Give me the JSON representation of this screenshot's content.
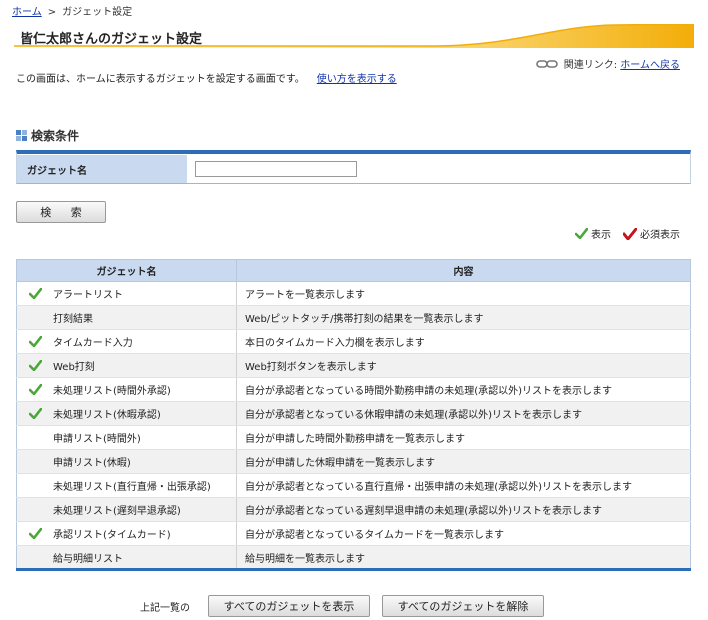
{
  "breadcrumb": {
    "home": "ホーム",
    "separator": ">",
    "current": "ガジェット設定"
  },
  "page_title": "皆仁太郎さんのガジェット設定",
  "related": {
    "label": "関連リンク:",
    "link": "ホームへ戻る"
  },
  "description": {
    "text": "この画面は、ホームに表示するガジェットを設定する画面です。",
    "help_link": "使い方を表示する"
  },
  "search": {
    "section_title": "検索条件",
    "field_label": "ガジェット名",
    "field_value": "",
    "button_label": "検 索"
  },
  "legend": {
    "display": "表示",
    "required": "必須表示"
  },
  "colors": {
    "check_green": "#4aa83a",
    "check_red": "#c8141e",
    "accent_blue": "#2d6cb6",
    "header_bg": "#c9d9ef"
  },
  "table": {
    "headers": {
      "name": "ガジェット名",
      "content": "内容"
    },
    "rows": [
      {
        "checked": true,
        "name": "アラートリスト",
        "content": "アラートを一覧表示します"
      },
      {
        "checked": false,
        "name": "打刻結果",
        "content": "Web/ピットタッチ/携帯打刻の結果を一覧表示します"
      },
      {
        "checked": true,
        "name": "タイムカード入力",
        "content": "本日のタイムカード入力欄を表示します"
      },
      {
        "checked": true,
        "name": "Web打刻",
        "content": "Web打刻ボタンを表示します"
      },
      {
        "checked": true,
        "name": "未処理リスト(時間外承認)",
        "content": "自分が承認者となっている時間外勤務申請の未処理(承認以外)リストを表示します"
      },
      {
        "checked": true,
        "name": "未処理リスト(休暇承認)",
        "content": "自分が承認者となっている休暇申請の未処理(承認以外)リストを表示します"
      },
      {
        "checked": false,
        "name": "申請リスト(時間外)",
        "content": "自分が申請した時間外勤務申請を一覧表示します"
      },
      {
        "checked": false,
        "name": "申請リスト(休暇)",
        "content": "自分が申請した休暇申請を一覧表示します"
      },
      {
        "checked": false,
        "name": "未処理リスト(直行直帰・出張承認)",
        "content": "自分が承認者となっている直行直帰・出張申請の未処理(承認以外)リストを表示します"
      },
      {
        "checked": false,
        "name": "未処理リスト(遅刻早退承認)",
        "content": "自分が承認者となっている遅刻早退申請の未処理(承認以外)リストを表示します"
      },
      {
        "checked": true,
        "name": "承認リスト(タイムカード)",
        "content": "自分が承認者となっているタイムカードを一覧表示します"
      },
      {
        "checked": false,
        "name": "給与明細リスト",
        "content": "給与明細を一覧表示します"
      }
    ]
  },
  "footer": {
    "label": "上記一覧の",
    "show_all": "すべてのガジェットを表示",
    "hide_all": "すべてのガジェットを解除"
  }
}
